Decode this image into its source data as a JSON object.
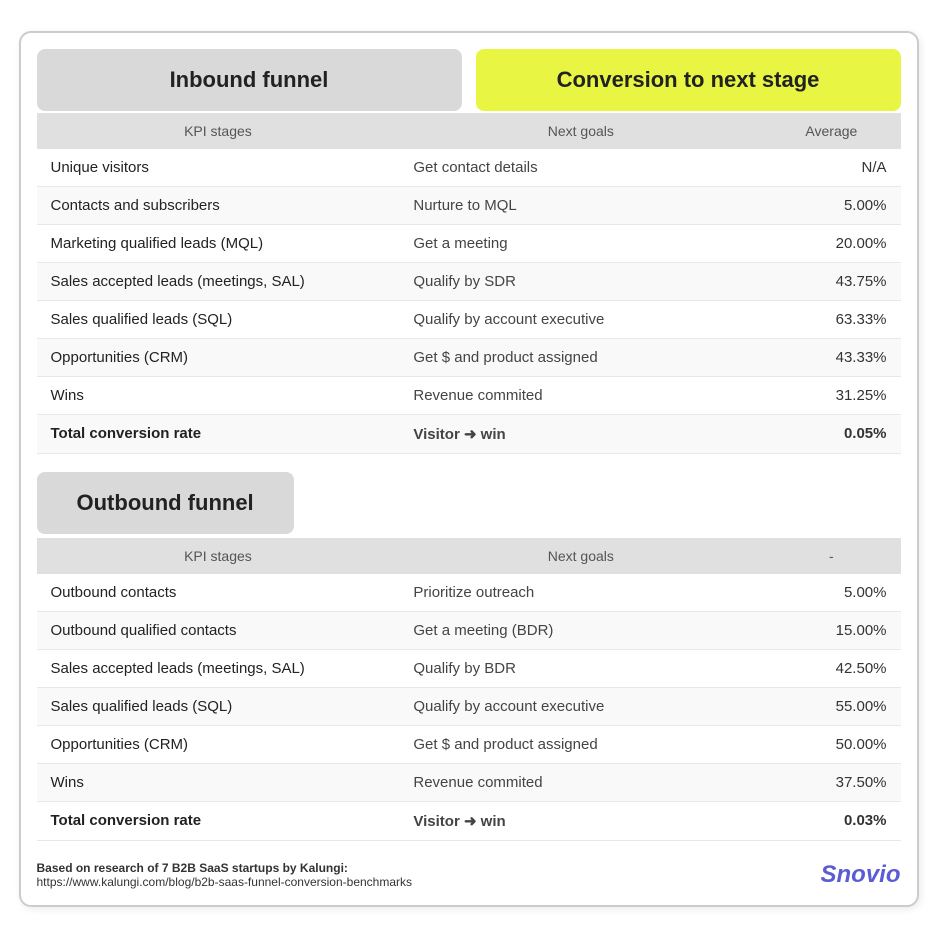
{
  "inbound": {
    "title_left": "Inbound funnel",
    "title_right": "Conversion to next stage",
    "col_kpi": "KPI stages",
    "col_goals": "Next goals",
    "col_avg": "Average",
    "rows": [
      {
        "kpi": "Unique visitors",
        "goal": "Get contact details",
        "avg": "N/A"
      },
      {
        "kpi": "Contacts and subscribers",
        "goal": "Nurture to MQL",
        "avg": "5.00%"
      },
      {
        "kpi": "Marketing qualified leads (MQL)",
        "goal": "Get a meeting",
        "avg": "20.00%"
      },
      {
        "kpi": "Sales accepted leads (meetings, SAL)",
        "goal": "Qualify by SDR",
        "avg": "43.75%"
      },
      {
        "kpi": "Sales qualified leads (SQL)",
        "goal": "Qualify by account executive",
        "avg": "63.33%"
      },
      {
        "kpi": "Opportunities (CRM)",
        "goal": "Get $ and product assigned",
        "avg": "43.33%"
      },
      {
        "kpi": "Wins",
        "goal": "Revenue commited",
        "avg": "31.25%"
      }
    ],
    "total_row": {
      "kpi": "Total conversion rate",
      "goal": "Visitor",
      "goal_suffix": "win",
      "avg": "0.05%"
    }
  },
  "outbound": {
    "title_left": "Outbound funnel",
    "col_kpi": "KPI stages",
    "col_goals": "Next goals",
    "col_avg": "-",
    "rows": [
      {
        "kpi": "Outbound contacts",
        "goal": "Prioritize outreach",
        "avg": "5.00%"
      },
      {
        "kpi": "Outbound qualified contacts",
        "goal": "Get a meeting (BDR)",
        "avg": "15.00%"
      },
      {
        "kpi": "Sales accepted leads (meetings, SAL)",
        "goal": "Qualify by BDR",
        "avg": "42.50%"
      },
      {
        "kpi": "Sales qualified leads (SQL)",
        "goal": "Qualify by account executive",
        "avg": "55.00%"
      },
      {
        "kpi": "Opportunities (CRM)",
        "goal": "Get $ and product assigned",
        "avg": "50.00%"
      },
      {
        "kpi": "Wins",
        "goal": "Revenue commited",
        "avg": "37.50%"
      }
    ],
    "total_row": {
      "kpi": "Total conversion rate",
      "goal": "Visitor",
      "goal_suffix": "win",
      "avg": "0.03%"
    }
  },
  "footer": {
    "bold_text": "Based on research of 7 B2B SaaS startups by Kalungi:",
    "url_text": "https://www.kalungi.com/blog/b2b-saas-funnel-conversion-benchmarks",
    "logo_text": "Snov",
    "logo_suffix": "io"
  }
}
